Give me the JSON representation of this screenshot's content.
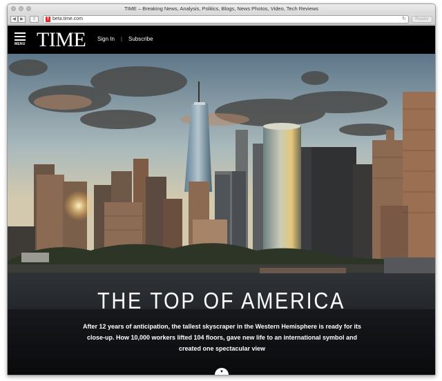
{
  "browser": {
    "window_title": "TIME – Breaking News, Analysis, Politics, Blogs, News Photos, Video, Tech Reviews",
    "url": "beta.time.com",
    "favicon_letter": "T",
    "reader_label": "Reader",
    "back_glyph": "◀",
    "forward_glyph": "▶",
    "share_glyph": "⇧",
    "reload_glyph": "↻"
  },
  "header": {
    "menu_label": "MENU",
    "logo": "TIME",
    "sign_in": "Sign In",
    "separator": "|",
    "subscribe": "Subscribe"
  },
  "hero": {
    "headline": "THE TOP OF AMERICA",
    "summary": "After 12 years of anticipation, the tallest skyscraper in the Western Hemisphere is ready for its close-up. How 10,000 workers lifted 104 floors, gave new life to an international symbol and created one spectacular view",
    "scroll_glyph": "▼"
  },
  "colors": {
    "header_bg": "#000000",
    "sky_top": "#5d7689",
    "water": "#1c2228"
  }
}
